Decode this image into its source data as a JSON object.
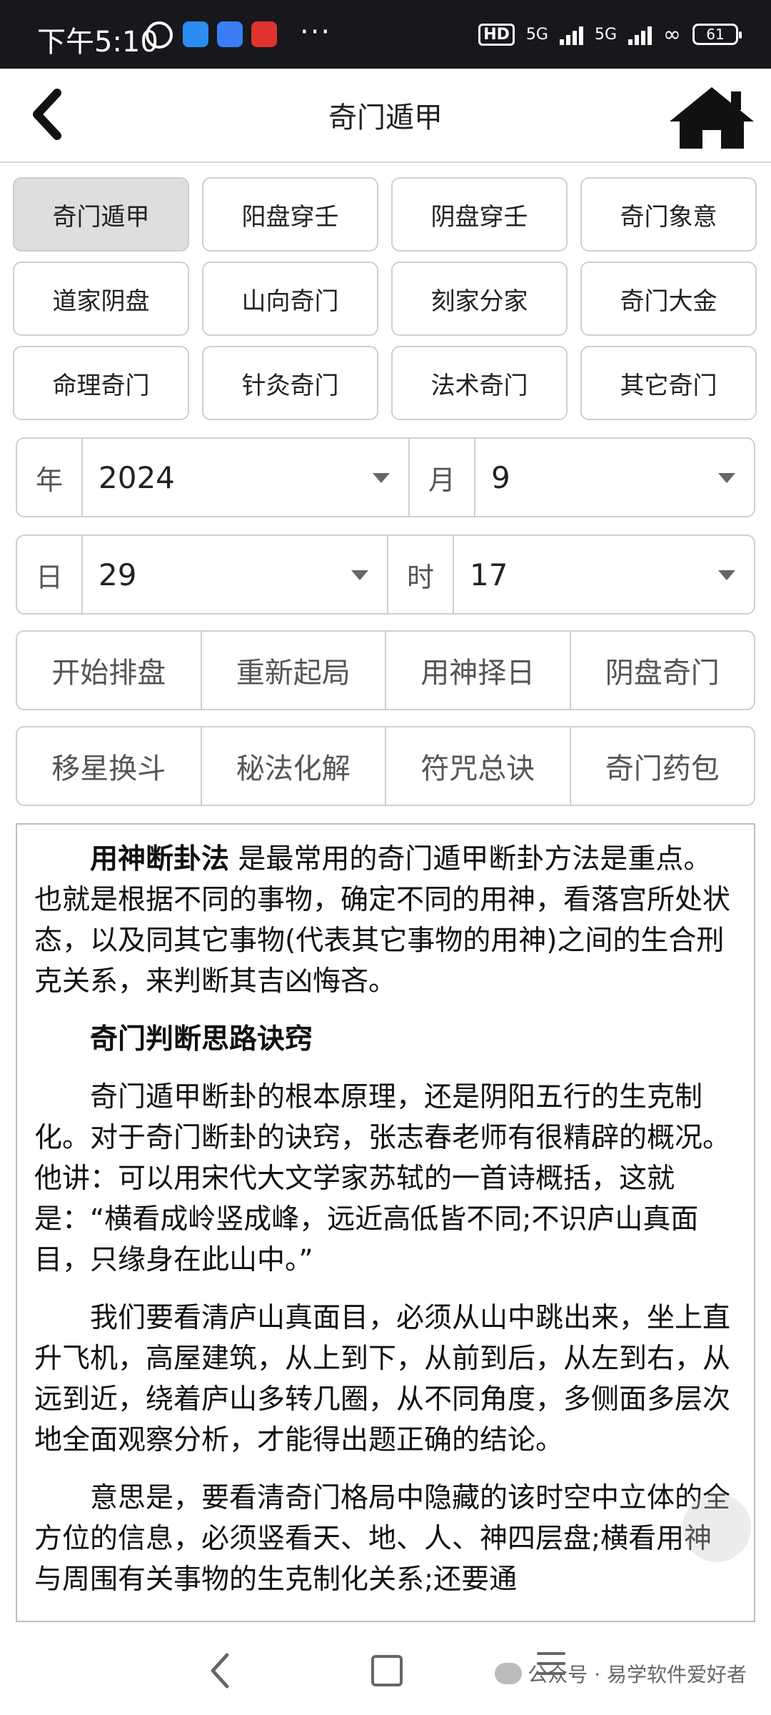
{
  "status_bar": {
    "time": "下午5:10",
    "dots": "···",
    "hd": "HD",
    "net1": "5G",
    "net2": "5G",
    "battery": "61"
  },
  "header": {
    "title": "奇门遁甲"
  },
  "categories": [
    {
      "label": "奇门遁甲",
      "active": true
    },
    {
      "label": "阳盘穿壬"
    },
    {
      "label": "阴盘穿壬"
    },
    {
      "label": "奇门象意"
    },
    {
      "label": "道家阴盘"
    },
    {
      "label": "山向奇门"
    },
    {
      "label": "刻家分家"
    },
    {
      "label": "奇门大金"
    },
    {
      "label": "命理奇门"
    },
    {
      "label": "针灸奇门"
    },
    {
      "label": "法术奇门"
    },
    {
      "label": "其它奇门"
    }
  ],
  "date_selects": {
    "year_label": "年",
    "year_value": "2024",
    "month_label": "月",
    "month_value": "9",
    "day_label": "日",
    "day_value": "29",
    "hour_label": "时",
    "hour_value": "17"
  },
  "actions_row1": [
    "开始排盘",
    "重新起局",
    "用神择日",
    "阴盘奇门"
  ],
  "actions_row2": [
    "移星换斗",
    "秘法化解",
    "符咒总诀",
    "奇门药包"
  ],
  "article": {
    "p1_strong": "用神断卦法",
    "p1_rest": " 是最常用的奇门遁甲断卦方法是重点。也就是根据不同的事物，确定不同的用神，看落宫所处状态，以及同其它事物(代表其它事物的用神)之间的生合刑克关系，来判断其吉凶悔吝。",
    "heading": "奇门判断思路诀窍",
    "p2": "奇门遁甲断卦的根本原理，还是阴阳五行的生克制化。对于奇门断卦的诀窍，张志春老师有很精辟的概况。他讲：可以用宋代大文学家苏轼的一首诗概括，这就是：“横看成岭竖成峰，远近高低皆不同;不识庐山真面目，只缘身在此山中。”",
    "p3": "我们要看清庐山真面目，必须从山中跳出来，坐上直升飞机，高屋建筑，从上到下，从前到后，从左到右，从远到近，绕着庐山多转几圈，从不同角度，多侧面多层次地全面观察分析，才能得出题正确的结论。",
    "p4": "意思是，要看清奇门格局中隐藏的该时空中立体的全方位的信息，必须竖看天、地、人、神四层盘;横看用神与周围有关事物的生克制化关系;还要通"
  },
  "watermark": {
    "text": "公众号 · 易学软件爱好者"
  },
  "colors": {
    "status_bar_bg": "#16181b",
    "active_tab_bg": "#dedede",
    "border": "#cfcfcf"
  }
}
